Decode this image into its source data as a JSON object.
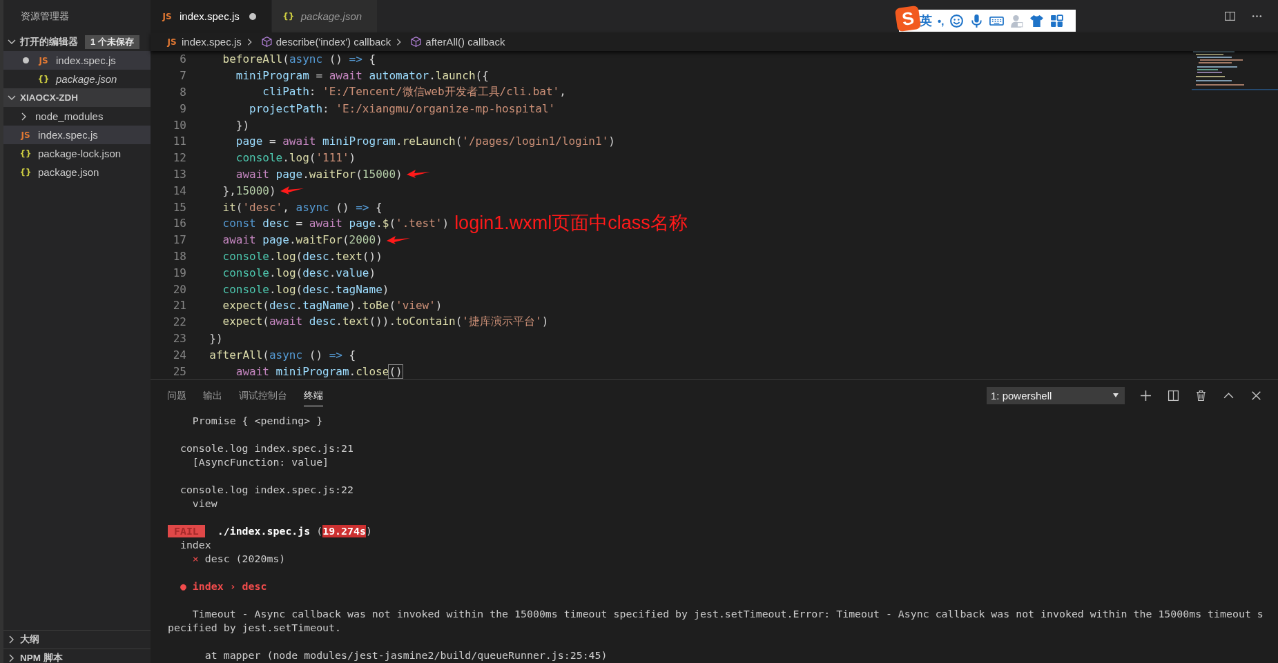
{
  "sidebar": {
    "title": "资源管理器",
    "sections": [
      {
        "title": "打开的编辑器",
        "badge": "1 个未保存",
        "expanded": true,
        "items": [
          {
            "label": "index.spec.js",
            "kind": "js",
            "icon": "JS",
            "dirty": true,
            "selected": true,
            "preview": false
          },
          {
            "label": "package.json",
            "kind": "json",
            "icon": "{}",
            "dirty": false,
            "selected": false,
            "preview": true
          }
        ]
      },
      {
        "title": "XIAOCX-ZDH",
        "expanded": true,
        "items": [
          {
            "label": "node_modules",
            "kind": "folder",
            "expanded": false,
            "selected": false
          },
          {
            "label": "index.spec.js",
            "kind": "js",
            "icon": "JS",
            "selected": true
          },
          {
            "label": "package-lock.json",
            "kind": "json",
            "icon": "{}",
            "selected": false
          },
          {
            "label": "package.json",
            "kind": "json",
            "icon": "{}",
            "selected": false
          }
        ]
      }
    ],
    "bottom_sections": [
      {
        "title": "大纲",
        "expanded": false
      },
      {
        "title": "NPM 脚本",
        "expanded": false
      }
    ]
  },
  "tabs": [
    {
      "label": "index.spec.js",
      "icon": "JS",
      "kind": "js",
      "selected": true,
      "dirty": true,
      "preview": false
    },
    {
      "label": "package.json",
      "icon": "{}",
      "kind": "json",
      "selected": false,
      "dirty": false,
      "preview": true
    }
  ],
  "ime_toolbar": {
    "logo": "S",
    "mode": "英",
    "punct": "•,"
  },
  "breadcrumb": [
    {
      "label": "index.spec.js",
      "icon": "JS",
      "kind": "file"
    },
    {
      "label": "describe('index') callback",
      "kind": "symbol"
    },
    {
      "label": "afterAll() callback",
      "kind": "symbol"
    }
  ],
  "editor": {
    "lines": [
      {
        "number": "6",
        "annotated": false,
        "tokens": [
          {
            "kind": "fn",
            "text": "    beforeAll"
          },
          {
            "kind": "plain",
            "text": "("
          },
          {
            "kind": "kw",
            "text": "async"
          },
          {
            "kind": "plain",
            "text": " () "
          },
          {
            "kind": "kw",
            "text": "=>"
          },
          {
            "kind": "plain",
            "text": " {"
          }
        ]
      },
      {
        "number": "7",
        "annotated": false,
        "tokens": [
          {
            "kind": "var",
            "text": "      miniProgram"
          },
          {
            "kind": "plain",
            "text": " = "
          },
          {
            "kind": "ctrl",
            "text": "await"
          },
          {
            "kind": "var",
            "text": " automator"
          },
          {
            "kind": "plain",
            "text": "."
          },
          {
            "kind": "fn",
            "text": "launch"
          },
          {
            "kind": "plain",
            "text": "({"
          }
        ]
      },
      {
        "number": "8",
        "annotated": false,
        "tokens": [
          {
            "kind": "var",
            "text": "          cliPath"
          },
          {
            "kind": "plain",
            "text": ": "
          },
          {
            "kind": "str",
            "text": "'E:/Tencent/微信web开发者工具/cli.bat'"
          },
          {
            "kind": "plain",
            "text": ","
          }
        ]
      },
      {
        "number": "9",
        "annotated": false,
        "tokens": [
          {
            "kind": "var",
            "text": "        projectPath"
          },
          {
            "kind": "plain",
            "text": ": "
          },
          {
            "kind": "str",
            "text": "'E:/xiangmu/organize-mp-hospital'"
          }
        ]
      },
      {
        "number": "10",
        "annotated": false,
        "tokens": [
          {
            "kind": "plain",
            "text": "      })"
          }
        ]
      },
      {
        "number": "11",
        "annotated": false,
        "tokens": [
          {
            "kind": "var",
            "text": "      page"
          },
          {
            "kind": "plain",
            "text": " = "
          },
          {
            "kind": "ctrl",
            "text": "await"
          },
          {
            "kind": "var",
            "text": " miniProgram"
          },
          {
            "kind": "plain",
            "text": "."
          },
          {
            "kind": "fn",
            "text": "reLaunch"
          },
          {
            "kind": "plain",
            "text": "("
          },
          {
            "kind": "str",
            "text": "'/pages/login1/login1'"
          },
          {
            "kind": "plain",
            "text": ")"
          }
        ]
      },
      {
        "number": "12",
        "annotated": false,
        "tokens": [
          {
            "kind": "cls",
            "text": "      console"
          },
          {
            "kind": "plain",
            "text": "."
          },
          {
            "kind": "fn",
            "text": "log"
          },
          {
            "kind": "plain",
            "text": "("
          },
          {
            "kind": "str",
            "text": "'111'"
          },
          {
            "kind": "plain",
            "text": ")"
          }
        ]
      },
      {
        "number": "13",
        "annotated": true,
        "tokens": [
          {
            "kind": "ctrl",
            "text": "      await"
          },
          {
            "kind": "var",
            "text": " page"
          },
          {
            "kind": "plain",
            "text": "."
          },
          {
            "kind": "fn",
            "text": "waitFor"
          },
          {
            "kind": "plain",
            "text": "("
          },
          {
            "kind": "num",
            "text": "15000"
          },
          {
            "kind": "plain",
            "text": ")"
          }
        ]
      },
      {
        "number": "14",
        "annotated": true,
        "tokens": [
          {
            "kind": "plain",
            "text": "    },"
          },
          {
            "kind": "num",
            "text": "15000"
          },
          {
            "kind": "plain",
            "text": ")"
          }
        ]
      },
      {
        "number": "15",
        "annotated": false,
        "tokens": [
          {
            "kind": "fn",
            "text": "    it"
          },
          {
            "kind": "plain",
            "text": "("
          },
          {
            "kind": "str",
            "text": "'desc'"
          },
          {
            "kind": "plain",
            "text": ", "
          },
          {
            "kind": "kw",
            "text": "async"
          },
          {
            "kind": "plain",
            "text": " () "
          },
          {
            "kind": "kw",
            "text": "=>"
          },
          {
            "kind": "plain",
            "text": " {"
          }
        ]
      },
      {
        "number": "16",
        "annotated": false,
        "note": "login1.wxml页面中class名称",
        "tokens": [
          {
            "kind": "kw",
            "text": "    const"
          },
          {
            "kind": "var",
            "text": " desc"
          },
          {
            "kind": "plain",
            "text": " = "
          },
          {
            "kind": "ctrl",
            "text": "await"
          },
          {
            "kind": "var",
            "text": " page"
          },
          {
            "kind": "plain",
            "text": "."
          },
          {
            "kind": "fn",
            "text": "$"
          },
          {
            "kind": "plain",
            "text": "("
          },
          {
            "kind": "str",
            "text": "'.test'"
          },
          {
            "kind": "plain",
            "text": ")"
          }
        ]
      },
      {
        "number": "17",
        "annotated": true,
        "tokens": [
          {
            "kind": "ctrl",
            "text": "    await"
          },
          {
            "kind": "var",
            "text": " page"
          },
          {
            "kind": "plain",
            "text": "."
          },
          {
            "kind": "fn",
            "text": "waitFor"
          },
          {
            "kind": "plain",
            "text": "("
          },
          {
            "kind": "num",
            "text": "2000"
          },
          {
            "kind": "plain",
            "text": ")"
          }
        ]
      },
      {
        "number": "18",
        "annotated": false,
        "tokens": [
          {
            "kind": "cls",
            "text": "    console"
          },
          {
            "kind": "plain",
            "text": "."
          },
          {
            "kind": "fn",
            "text": "log"
          },
          {
            "kind": "plain",
            "text": "("
          },
          {
            "kind": "var",
            "text": "desc"
          },
          {
            "kind": "plain",
            "text": "."
          },
          {
            "kind": "fn",
            "text": "text"
          },
          {
            "kind": "plain",
            "text": "())"
          }
        ]
      },
      {
        "number": "19",
        "annotated": false,
        "tokens": [
          {
            "kind": "cls",
            "text": "    console"
          },
          {
            "kind": "plain",
            "text": "."
          },
          {
            "kind": "fn",
            "text": "log"
          },
          {
            "kind": "plain",
            "text": "("
          },
          {
            "kind": "var",
            "text": "desc"
          },
          {
            "kind": "plain",
            "text": "."
          },
          {
            "kind": "var",
            "text": "value"
          },
          {
            "kind": "plain",
            "text": ")"
          }
        ]
      },
      {
        "number": "20",
        "annotated": false,
        "tokens": [
          {
            "kind": "cls",
            "text": "    console"
          },
          {
            "kind": "plain",
            "text": "."
          },
          {
            "kind": "fn",
            "text": "log"
          },
          {
            "kind": "plain",
            "text": "("
          },
          {
            "kind": "var",
            "text": "desc"
          },
          {
            "kind": "plain",
            "text": "."
          },
          {
            "kind": "var",
            "text": "tagName"
          },
          {
            "kind": "plain",
            "text": ")"
          }
        ]
      },
      {
        "number": "21",
        "annotated": false,
        "tokens": [
          {
            "kind": "fn",
            "text": "    expect"
          },
          {
            "kind": "plain",
            "text": "("
          },
          {
            "kind": "var",
            "text": "desc"
          },
          {
            "kind": "plain",
            "text": "."
          },
          {
            "kind": "var",
            "text": "tagName"
          },
          {
            "kind": "plain",
            "text": ")."
          },
          {
            "kind": "fn",
            "text": "toBe"
          },
          {
            "kind": "plain",
            "text": "("
          },
          {
            "kind": "str",
            "text": "'view'"
          },
          {
            "kind": "plain",
            "text": ")"
          }
        ]
      },
      {
        "number": "22",
        "annotated": false,
        "tokens": [
          {
            "kind": "fn",
            "text": "    expect"
          },
          {
            "kind": "plain",
            "text": "("
          },
          {
            "kind": "ctrl",
            "text": "await"
          },
          {
            "kind": "var",
            "text": " desc"
          },
          {
            "kind": "plain",
            "text": "."
          },
          {
            "kind": "fn",
            "text": "text"
          },
          {
            "kind": "plain",
            "text": "())."
          },
          {
            "kind": "fn",
            "text": "toContain"
          },
          {
            "kind": "plain",
            "text": "("
          },
          {
            "kind": "str",
            "text": "'捷库演示平台'"
          },
          {
            "kind": "plain",
            "text": ")"
          }
        ]
      },
      {
        "number": "23",
        "annotated": false,
        "tokens": [
          {
            "kind": "plain",
            "text": "  })"
          }
        ]
      },
      {
        "number": "24",
        "annotated": false,
        "tokens": [
          {
            "kind": "fn",
            "text": "  afterAll"
          },
          {
            "kind": "plain",
            "text": "("
          },
          {
            "kind": "kw",
            "text": "async"
          },
          {
            "kind": "plain",
            "text": " () "
          },
          {
            "kind": "kw",
            "text": "=>"
          },
          {
            "kind": "plain",
            "text": " {"
          }
        ]
      },
      {
        "number": "25",
        "annotated": false,
        "tokens": [
          {
            "kind": "ctrl",
            "text": "      await"
          },
          {
            "kind": "var",
            "text": " miniProgram"
          },
          {
            "kind": "plain",
            "text": "."
          },
          {
            "kind": "fn",
            "text": "close"
          },
          {
            "kind": "match",
            "text": "()"
          }
        ]
      }
    ]
  },
  "panel": {
    "tabs": [
      {
        "label": "问题",
        "selected": false
      },
      {
        "label": "输出",
        "selected": false
      },
      {
        "label": "调试控制台",
        "selected": false
      },
      {
        "label": "终端",
        "selected": true
      }
    ],
    "terminal_select": "1: powershell",
    "terminal": [
      [
        [
          {
            "kind": "plain",
            "text": "    Promise { <pending> }"
          }
        ]
      ],
      [
        [
          {
            "kind": "plain",
            "text": "  console.log index.spec.js:21"
          }
        ],
        [
          {
            "kind": "plain",
            "text": "    [AsyncFunction: value]"
          }
        ]
      ],
      [
        [
          {
            "kind": "plain",
            "text": "  console.log index.spec.js:22"
          }
        ],
        [
          {
            "kind": "plain",
            "text": "    view"
          }
        ]
      ],
      [
        [
          {
            "kind": "fail",
            "text": " FAIL "
          },
          {
            "kind": "bold",
            "text": " ./index.spec.js"
          },
          {
            "kind": "plain",
            "text": " ("
          },
          {
            "kind": "time",
            "text": "19.274s"
          },
          {
            "kind": "plain",
            "text": ")"
          }
        ],
        [
          {
            "kind": "plain",
            "text": "  index"
          }
        ],
        [
          {
            "kind": "red",
            "text": "    ×"
          },
          {
            "kind": "plain",
            "text": " desc (2020ms)"
          }
        ]
      ],
      [
        [
          {
            "kind": "redbold",
            "text": "  ● index › desc"
          }
        ]
      ],
      [
        [
          {
            "kind": "plain",
            "text": "    Timeout - Async callback was not invoked within the 15000ms timeout specified by jest.setTimeout.Error: Timeout - Async callback was not invoked within the 15000ms timeout s"
          }
        ],
        [
          {
            "kind": "plain",
            "text": "pecified by jest.setTimeout."
          }
        ]
      ],
      [
        [
          {
            "kind": "plain",
            "text": "      at mapper (node modules/jest-jasmine2/build/queueRunner.js:25:45)"
          }
        ]
      ]
    ]
  }
}
